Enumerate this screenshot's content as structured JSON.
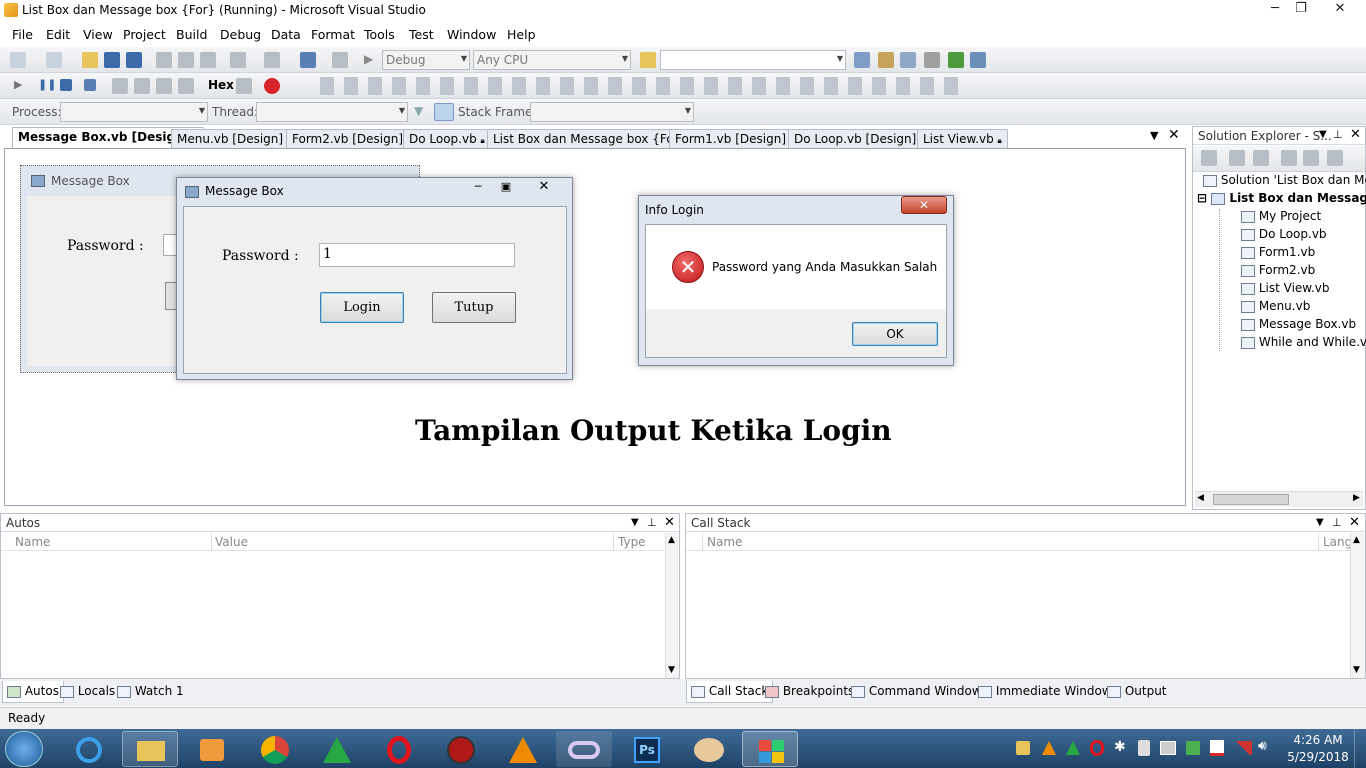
{
  "window": {
    "title": "List Box dan Message box {For} (Running) - Microsoft Visual Studio",
    "controls": [
      "─",
      "❐",
      "✕"
    ]
  },
  "menu": [
    "File",
    "Edit",
    "View",
    "Project",
    "Build",
    "Debug",
    "Data",
    "Format",
    "Tools",
    "Test",
    "Window",
    "Help"
  ],
  "toolbar": {
    "config": "Debug",
    "platform": "Any CPU",
    "hex_label": "Hex",
    "process_label": "Process:",
    "thread_label": "Thread:",
    "stackframe_label": "Stack Frame:"
  },
  "tabs": [
    {
      "label": "Message Box.vb [Design]",
      "active": true
    },
    {
      "label": "Menu.vb [Design]"
    },
    {
      "label": "Form2.vb [Design]"
    },
    {
      "label": "Do Loop.vb"
    },
    {
      "label": "List Box dan Message box {For}*"
    },
    {
      "label": "Form1.vb [Design]"
    },
    {
      "label": "Do Loop.vb [Design]"
    },
    {
      "label": "List View.vb"
    }
  ],
  "design_form": {
    "title": "Message Box",
    "password_label": "Password :"
  },
  "runtime_form": {
    "title": "Message Box",
    "password_label": "Password :",
    "password_value": "1",
    "login_button": "Login",
    "close_button": "Tutup"
  },
  "info_dialog": {
    "title": "Info Login",
    "message": "Password yang Anda Masukkan Salah",
    "ok_button": "OK"
  },
  "caption": "Tampilan Output Ketika Login",
  "solution_explorer": {
    "title": "Solution Explorer - S...",
    "solution": "Solution 'List Box dan Message",
    "project": "List Box dan Message",
    "items": [
      "My Project",
      "Do Loop.vb",
      "Form1.vb",
      "Form2.vb",
      "List View.vb",
      "Menu.vb",
      "Message Box.vb",
      "While and While.vb"
    ]
  },
  "autos": {
    "title": "Autos",
    "columns": [
      "Name",
      "Value",
      "Type"
    ]
  },
  "callstack": {
    "title": "Call Stack",
    "columns": [
      "Name",
      "Lang"
    ]
  },
  "bottom_tabs_left": [
    "Autos",
    "Locals",
    "Watch 1"
  ],
  "bottom_tabs_right": [
    "Call Stack",
    "Breakpoints",
    "Command Window",
    "Immediate Window",
    "Output"
  ],
  "status": "Ready",
  "clock": {
    "time": "4:26 AM",
    "date": "5/29/2018"
  },
  "colors": {
    "error": "#d8262c",
    "accent": "#3a6ea5"
  }
}
